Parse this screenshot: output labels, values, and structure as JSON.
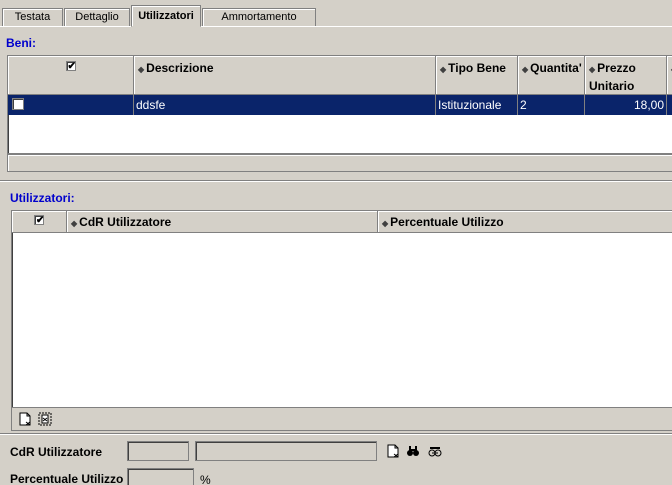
{
  "tabs": [
    {
      "label": "Testata",
      "active": false
    },
    {
      "label": "Dettaglio",
      "active": false
    },
    {
      "label": "Utilizzatori",
      "active": true
    },
    {
      "label": "Ammortamento",
      "active": false
    }
  ],
  "beni": {
    "title": "Beni:",
    "columns": [
      "Descrizione",
      "Tipo Bene",
      "Quantita'",
      "Prezzo Unitario"
    ],
    "rows": [
      {
        "descrizione": "ddsfe",
        "tipo_bene": "Istituzionale",
        "quantita": "2",
        "prezzo": "18,00"
      }
    ],
    "selected_color": "#0a246a"
  },
  "utilizzatori": {
    "title": "Utilizzatori:",
    "columns": [
      "CdR Utilizzatore",
      "Percentuale Utilizzo"
    ]
  },
  "form": {
    "cdr_label": "CdR Utilizzatore",
    "percent_label": "Percentuale Utilizzo",
    "percent_unit": "%"
  },
  "icons": {
    "new": "new-row-icon",
    "delete": "delete-row-icon",
    "new_doc": "new-document-icon",
    "search": "binoculars-icon",
    "search_clear": "binoculars-clear-icon"
  }
}
